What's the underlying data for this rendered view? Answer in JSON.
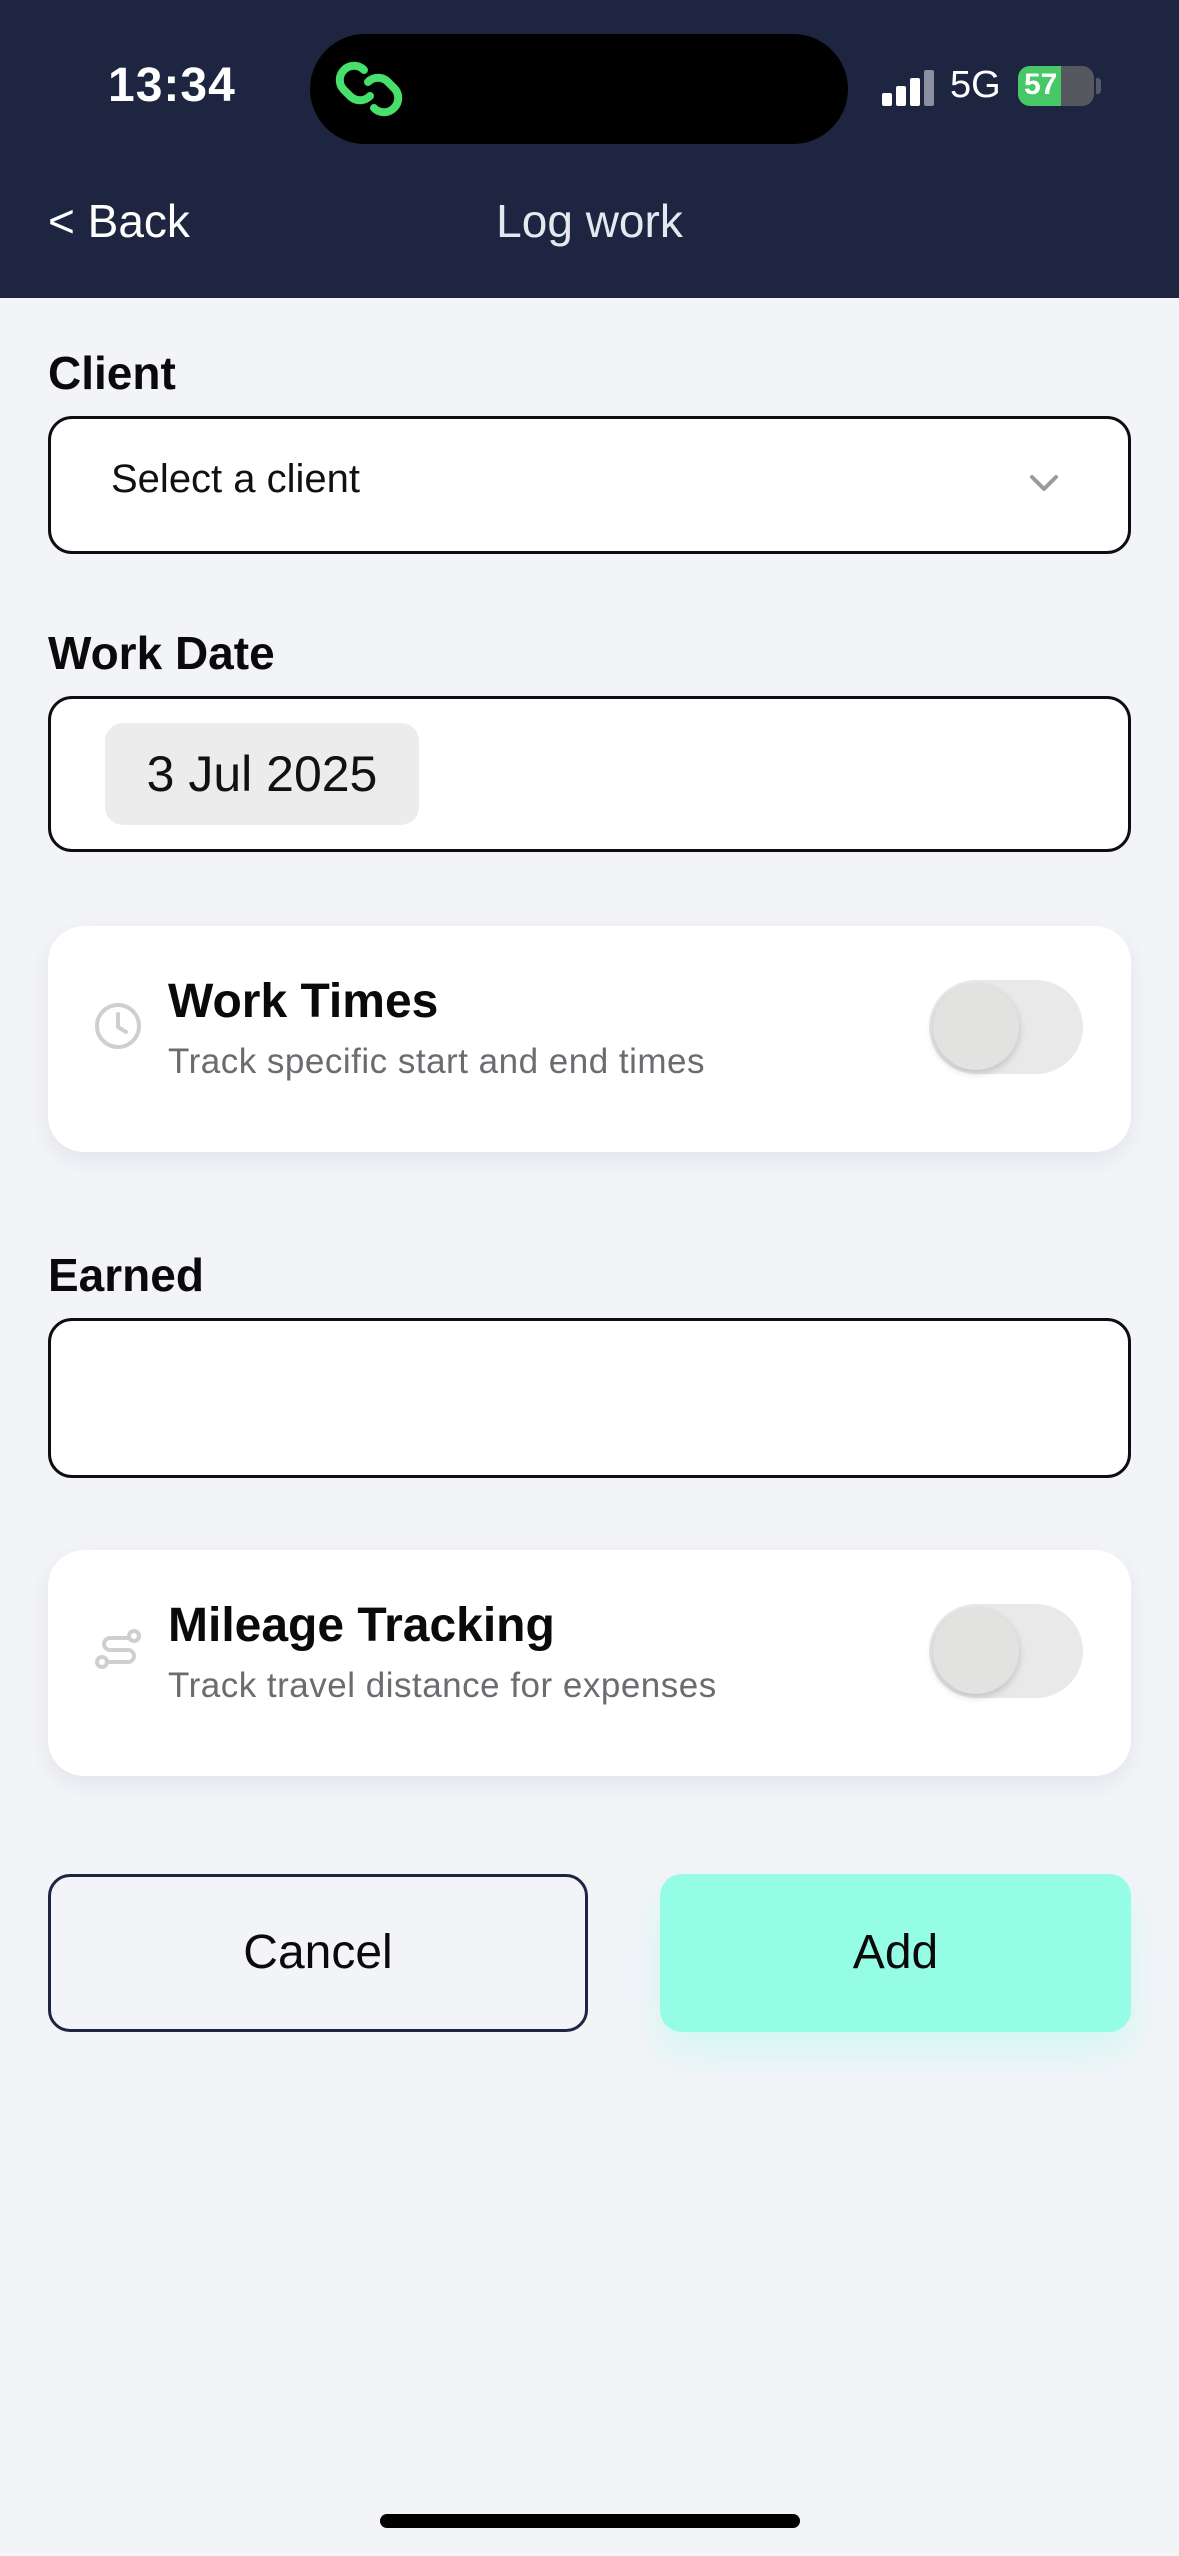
{
  "status_bar": {
    "time": "13:34",
    "network": "5G",
    "battery": "57"
  },
  "nav": {
    "back_label": "< Back",
    "title": "Log work"
  },
  "client": {
    "label": "Client",
    "placeholder": "Select a client"
  },
  "work_date": {
    "label": "Work Date",
    "value": "3 Jul 2025"
  },
  "work_times": {
    "title": "Work Times",
    "subtitle": "Track specific start and end times",
    "enabled": false,
    "icon": "clock-icon"
  },
  "earned": {
    "label": "Earned",
    "value": ""
  },
  "mileage": {
    "title": "Mileage Tracking",
    "subtitle": "Track travel distance for expenses",
    "enabled": false,
    "icon": "route-icon"
  },
  "actions": {
    "cancel_label": "Cancel",
    "add_label": "Add"
  },
  "colors": {
    "header": "#1e2541",
    "background": "#f3f4f8",
    "accent": "#95fce6",
    "logo": "#46e06a"
  }
}
